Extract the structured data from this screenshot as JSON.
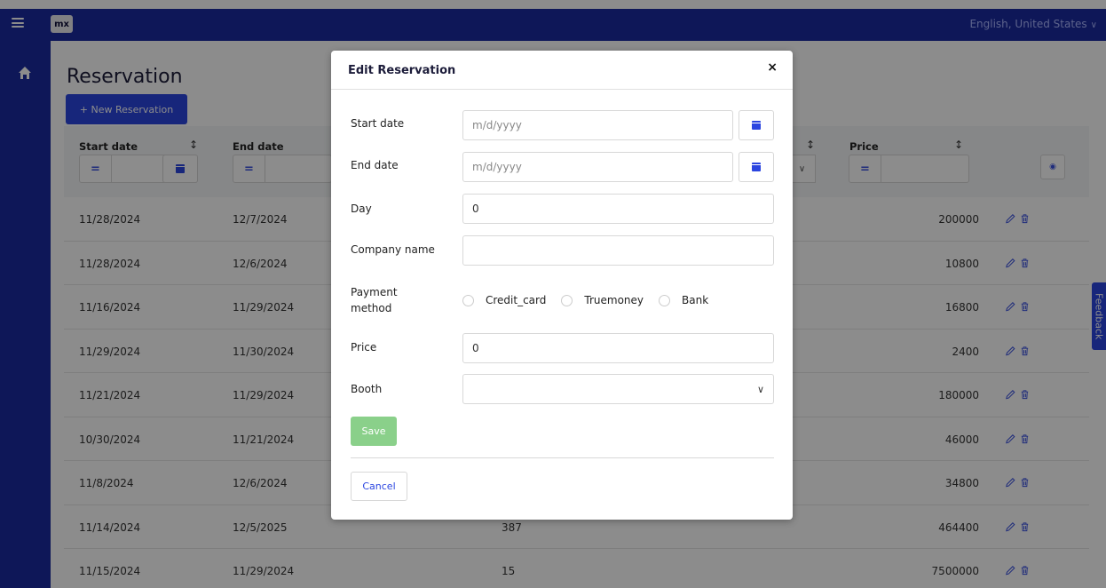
{
  "topbar": {
    "logo_text": "mx",
    "language": "English, United States",
    "color": "#1b2aa0"
  },
  "sidebar": {
    "items": [
      {
        "icon": "home-icon"
      }
    ]
  },
  "page": {
    "title": "Reservation",
    "new_button": "+ New Reservation"
  },
  "table": {
    "columns": [
      "Start date",
      "End date",
      "Price"
    ],
    "rows": [
      {
        "start": "11/28/2024",
        "end": "12/7/2024",
        "day": "",
        "price": "200000"
      },
      {
        "start": "11/28/2024",
        "end": "12/6/2024",
        "day": "",
        "price": "10800"
      },
      {
        "start": "11/16/2024",
        "end": "11/29/2024",
        "day": "",
        "price": "16800"
      },
      {
        "start": "11/29/2024",
        "end": "11/30/2024",
        "day": "",
        "price": "2400"
      },
      {
        "start": "11/21/2024",
        "end": "11/29/2024",
        "day": "",
        "price": "180000"
      },
      {
        "start": "10/30/2024",
        "end": "11/21/2024",
        "day": "",
        "price": "46000"
      },
      {
        "start": "11/8/2024",
        "end": "12/6/2024",
        "day": "",
        "price": "34800"
      },
      {
        "start": "11/14/2024",
        "end": "12/5/2025",
        "day": "387",
        "price": "464400"
      },
      {
        "start": "11/15/2024",
        "end": "11/29/2024",
        "day": "15",
        "price": "7500000"
      }
    ]
  },
  "feedback_label": "Feedback",
  "modal": {
    "title": "Edit Reservation",
    "close": "×",
    "fields": {
      "start_date": {
        "label": "Start date",
        "placeholder": "m/d/yyyy"
      },
      "end_date": {
        "label": "End date",
        "placeholder": "m/d/yyyy"
      },
      "day": {
        "label": "Day",
        "value": "0"
      },
      "company_name": {
        "label": "Company name",
        "value": ""
      },
      "payment_method": {
        "label": "Payment method",
        "options": [
          "Credit_card",
          "Truemoney",
          "Bank"
        ]
      },
      "price": {
        "label": "Price",
        "value": "0"
      },
      "booth": {
        "label": "Booth",
        "value": ""
      }
    },
    "save": "Save",
    "cancel": "Cancel"
  },
  "colors": {
    "accent": "#2b45e0",
    "save": "#8ad08a"
  }
}
